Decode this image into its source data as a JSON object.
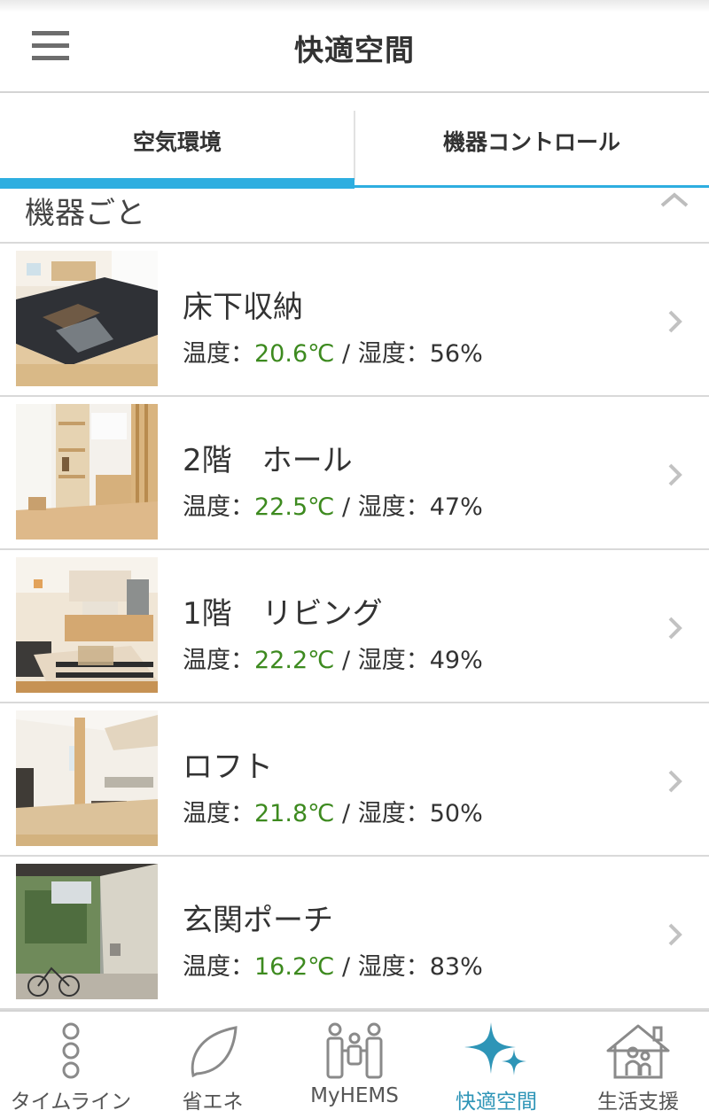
{
  "header": {
    "title": "快適空間",
    "menu_icon": "hamburger-menu-icon"
  },
  "tabs": [
    {
      "label": "空気環境",
      "active": true
    },
    {
      "label": "機器コントロール",
      "active": false
    }
  ],
  "section": {
    "title": "機器ごと",
    "collapse_icon": "chevron-up-icon"
  },
  "items": [
    {
      "name": "床下収納",
      "temp_label": "温度：",
      "temp": "20.6℃",
      "sep": " / ",
      "hum_label": "湿度：",
      "hum": "56%",
      "photo": "tatami-room-photo"
    },
    {
      "name": "2階　ホール",
      "temp_label": "温度：",
      "temp": "22.5℃",
      "sep": " / ",
      "hum_label": "湿度：",
      "hum": "47%",
      "photo": "hall-photo"
    },
    {
      "name": "1階　リビング",
      "temp_label": "温度：",
      "temp": "22.2℃",
      "sep": " / ",
      "hum_label": "湿度：",
      "hum": "49%",
      "photo": "living-room-photo"
    },
    {
      "name": "ロフト",
      "temp_label": "温度：",
      "temp": "21.8℃",
      "sep": " / ",
      "hum_label": "湿度：",
      "hum": "50%",
      "photo": "loft-photo"
    },
    {
      "name": "玄関ポーチ",
      "temp_label": "温度：",
      "temp": "16.2℃",
      "sep": " / ",
      "hum_label": "湿度：",
      "hum": "83%",
      "photo": "entrance-porch-photo"
    }
  ],
  "bottom_nav": [
    {
      "label": "タイムライン",
      "icon": "timeline-icon",
      "active": false
    },
    {
      "label": "省エネ",
      "icon": "leaf-icon",
      "active": false
    },
    {
      "label": "MyHEMS",
      "icon": "family-icon",
      "active": false
    },
    {
      "label": "快適空間",
      "icon": "sparkle-icon",
      "active": true
    },
    {
      "label": "生活支援",
      "icon": "house-people-icon",
      "active": false
    }
  ],
  "colors": {
    "accent": "#2eaee0",
    "active_nav": "#2e95b7",
    "temperature": "#3d8a1f",
    "text": "#333333",
    "divider": "#d9d9d9"
  }
}
